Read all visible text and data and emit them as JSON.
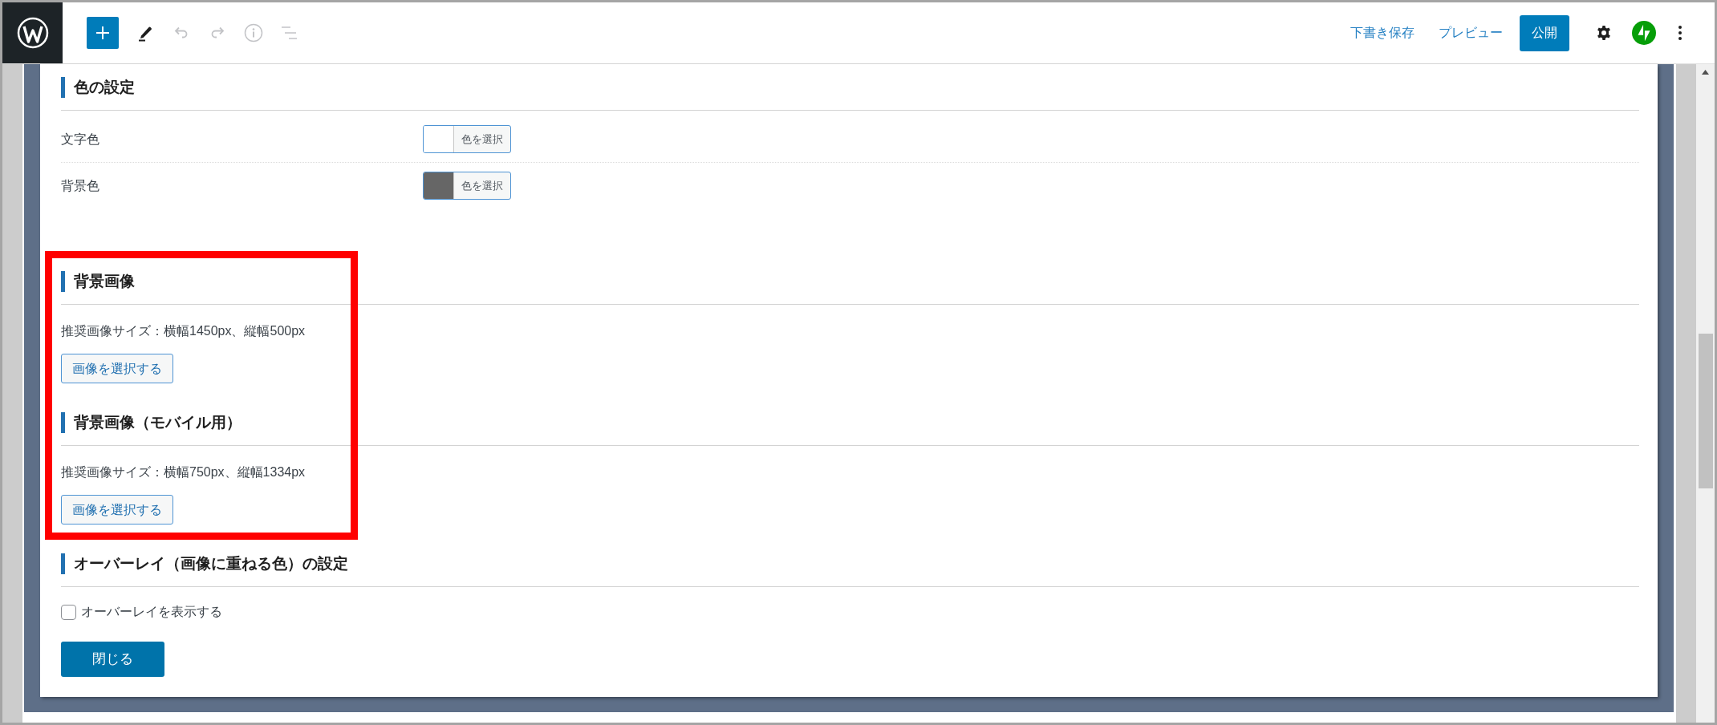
{
  "toolbar": {
    "tools": [
      {
        "kind": "edit",
        "disabled": false
      },
      {
        "kind": "undo",
        "disabled": true
      },
      {
        "kind": "redo",
        "disabled": true
      },
      {
        "kind": "info",
        "disabled": true
      },
      {
        "kind": "outline",
        "disabled": true
      }
    ],
    "actions": [
      {
        "kind": "link",
        "label": "下書き保存"
      },
      {
        "kind": "link",
        "label": "プレビュー"
      },
      {
        "kind": "primary",
        "label": "公開"
      }
    ]
  },
  "sections": [
    {
      "title": "色の設定",
      "highlighted": false,
      "rows": [
        {
          "kind": "color",
          "label": "文字色",
          "button": "色を選択",
          "color": "#ffffff"
        },
        {
          "kind": "color",
          "label": "背景色",
          "button": "色を選択",
          "color": "#666666"
        }
      ]
    },
    {
      "title": "背景画像",
      "highlighted": true,
      "rows": [
        {
          "kind": "note",
          "text": "推奨画像サイズ：横幅1450px、縦幅500px"
        },
        {
          "kind": "button",
          "label": "画像を選択する"
        }
      ]
    },
    {
      "title": "背景画像（モバイル用）",
      "highlighted": true,
      "rows": [
        {
          "kind": "note",
          "text": "推奨画像サイズ：横幅750px、縦幅1334px"
        },
        {
          "kind": "button",
          "label": "画像を選択する"
        }
      ]
    },
    {
      "title": "オーバーレイ（画像に重ねる色）の設定",
      "highlighted": false,
      "rows": [
        {
          "kind": "checkbox",
          "label": "オーバーレイを表示する",
          "checked": false
        }
      ]
    }
  ],
  "close_button": {
    "label": "閉じる"
  }
}
